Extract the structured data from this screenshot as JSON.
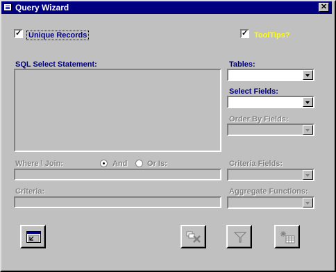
{
  "window": {
    "title": "Query Wizard",
    "close_label": "✕"
  },
  "unique_records": {
    "label": "Unique Records",
    "checked": true
  },
  "tooltips": {
    "label": "ToolTips?",
    "checked": true
  },
  "sql": {
    "label": "SQL Select Statement:",
    "value": ""
  },
  "tables": {
    "label": "Tables:",
    "value": ""
  },
  "select_fields": {
    "label": "Select Fields:",
    "value": ""
  },
  "order_by": {
    "label": "Order By Fields:",
    "value": ""
  },
  "where": {
    "label": "Where \\ Join:",
    "value": "",
    "and_label": "And",
    "or_label": "Or Is:"
  },
  "criteria_fields": {
    "label": "Criteria Fields:",
    "value": ""
  },
  "criteria": {
    "label": "Criteria:",
    "value": ""
  },
  "aggregate": {
    "label": "Aggregate Functions:",
    "value": ""
  },
  "buttons": [
    {
      "icon": "exit-form-icon"
    },
    {
      "icon": "clear-query-icon"
    },
    {
      "icon": "filter-icon"
    },
    {
      "icon": "run-query-icon"
    }
  ],
  "colors": {
    "titlebar": "#000080",
    "label": "#000080",
    "tooltips": "#ffff00",
    "face": "#c0c0c0"
  }
}
